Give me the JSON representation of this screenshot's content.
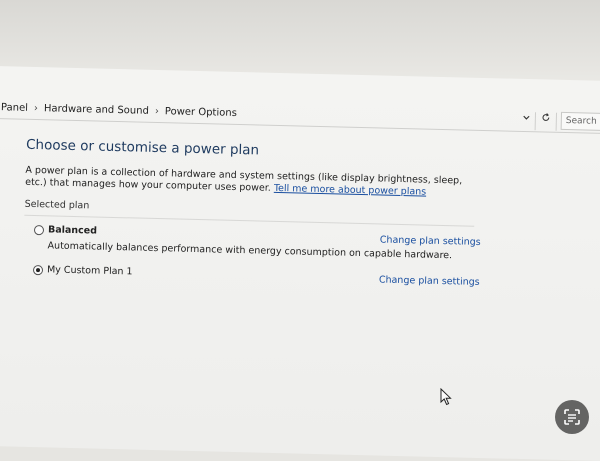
{
  "breadcrumb": {
    "items": [
      "Panel",
      "Hardware and Sound",
      "Power Options"
    ]
  },
  "address_tools": {
    "dropdown": "chevron-down-icon",
    "refresh": "refresh-icon",
    "search_placeholder": "Search"
  },
  "page": {
    "title": "Choose or customise a power plan",
    "description": "A power plan is a collection of hardware and system settings (like display brightness, sleep, etc.) that manages how your computer uses power.",
    "help_link": "Tell me more about power plans",
    "section_label": "Selected plan"
  },
  "plans": [
    {
      "name": "Balanced",
      "selected": false,
      "description": "Automatically balances performance with energy consumption on capable hardware.",
      "link": "Change plan settings"
    },
    {
      "name": "My Custom Plan 1",
      "selected": true,
      "description": "",
      "link": "Change plan settings"
    }
  ],
  "colors": {
    "link": "#1a4fa0",
    "title": "#1e3a5f"
  }
}
